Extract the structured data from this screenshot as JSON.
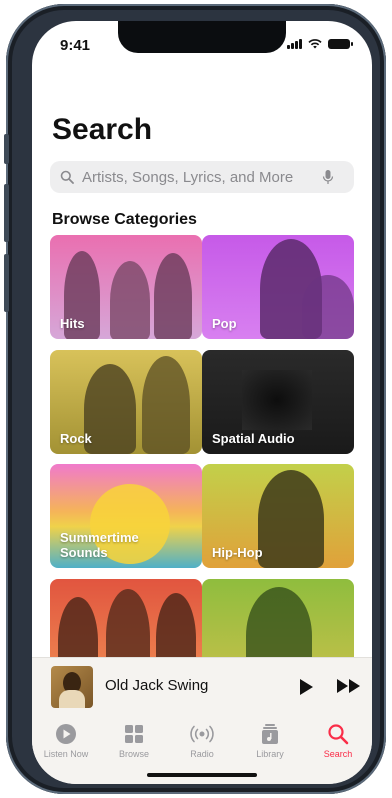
{
  "status_bar": {
    "time": "9:41"
  },
  "page": {
    "title": "Search"
  },
  "search": {
    "placeholder": "Artists, Songs, Lyrics, and More"
  },
  "browse": {
    "heading": "Browse Categories",
    "categories": [
      {
        "label": "Hits",
        "color_top": "#ea6fb0",
        "color_bottom": "#d6a7d8"
      },
      {
        "label": "Pop",
        "color_top": "#c65ae8",
        "color_bottom": "#d880f0"
      },
      {
        "label": "Rock",
        "color_top": "#d8c25a",
        "color_bottom": "#a39234"
      },
      {
        "label": "Spatial Audio",
        "color_top": "#2a2a2a",
        "color_bottom": "#1a1a1a"
      },
      {
        "label": "Summertime Sounds",
        "color_top": "#f07acb",
        "color_bottom": "#4fb0c8"
      },
      {
        "label": "Hip-Hop",
        "color_top": "#c2d04a",
        "color_bottom": "#e0a13a"
      },
      {
        "label": "",
        "color_top": "#e1553f",
        "color_bottom": "#ef8a52"
      },
      {
        "label": "",
        "color_top": "#8fbd3e",
        "color_bottom": "#c6c04a"
      }
    ]
  },
  "mini_player": {
    "title": "Old Jack Swing"
  },
  "tabs": [
    {
      "label": "Listen Now",
      "icon": "play-circle-icon",
      "active": false
    },
    {
      "label": "Browse",
      "icon": "grid-icon",
      "active": false
    },
    {
      "label": "Radio",
      "icon": "radio-icon",
      "active": false
    },
    {
      "label": "Library",
      "icon": "library-icon",
      "active": false
    },
    {
      "label": "Search",
      "icon": "search-icon",
      "active": true
    }
  ],
  "colors": {
    "accent": "#fa2d48",
    "text": "#111111",
    "muted": "#8a8a8e"
  }
}
